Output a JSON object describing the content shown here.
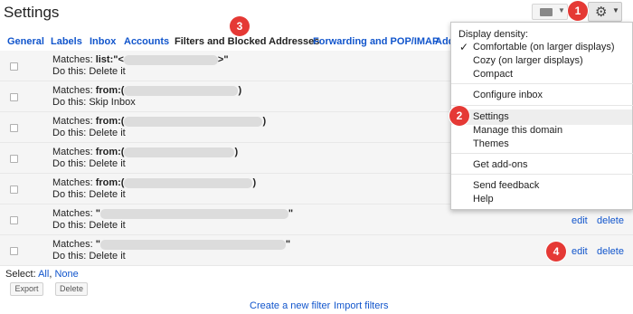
{
  "header": {
    "title": "Settings"
  },
  "annotations": [
    "1",
    "2",
    "3",
    "4"
  ],
  "tabs": [
    {
      "label": "General"
    },
    {
      "label": "Labels"
    },
    {
      "label": "Inbox"
    },
    {
      "label": "Accounts"
    },
    {
      "label": "Filters and Blocked Addresses"
    },
    {
      "label": "Forwarding and POP/IMAP"
    },
    {
      "label": "Add"
    }
  ],
  "filters": [
    {
      "prefix": "Matches: ",
      "field": "list:",
      "open": "\"<",
      "close": ">\"",
      "action": "Do this: Delete it"
    },
    {
      "prefix": "Matches: ",
      "field": "from:",
      "open": "(",
      "close": ")",
      "action": "Do this: Skip Inbox"
    },
    {
      "prefix": "Matches: ",
      "field": "from:",
      "open": "(",
      "close": ")",
      "action": "Do this: Delete it"
    },
    {
      "prefix": "Matches: ",
      "field": "from:",
      "open": "(",
      "close": ")",
      "action": "Do this: Delete it"
    },
    {
      "prefix": "Matches: ",
      "field": "from:",
      "open": "(",
      "close": ")",
      "action": "Do this: Delete it"
    },
    {
      "prefix": "Matches: ",
      "field": "",
      "open": "\"",
      "close": "\"",
      "action": "Do this: Delete it",
      "edit": "edit",
      "delete": "delete"
    },
    {
      "prefix": "Matches: ",
      "field": "",
      "open": "\"",
      "close": "\"",
      "action": "Do this: Delete it",
      "edit": "edit",
      "delete": "delete"
    }
  ],
  "footer": {
    "select_prefix": "Select: ",
    "select_all": "All",
    "select_sep": ", ",
    "select_none": "None",
    "export_label": "Export",
    "delete_label": "Delete",
    "create_filter": "Create a new filter",
    "import_filters": "Import filters"
  },
  "menu": {
    "density_label": "Display density:",
    "comfortable": "Comfortable (on larger displays)",
    "cozy": "Cozy (on larger displays)",
    "compact": "Compact",
    "configure_inbox": "Configure inbox",
    "settings": "Settings",
    "manage_domain": "Manage this domain",
    "themes": "Themes",
    "get_addons": "Get add-ons",
    "send_feedback": "Send feedback",
    "help": "Help"
  }
}
